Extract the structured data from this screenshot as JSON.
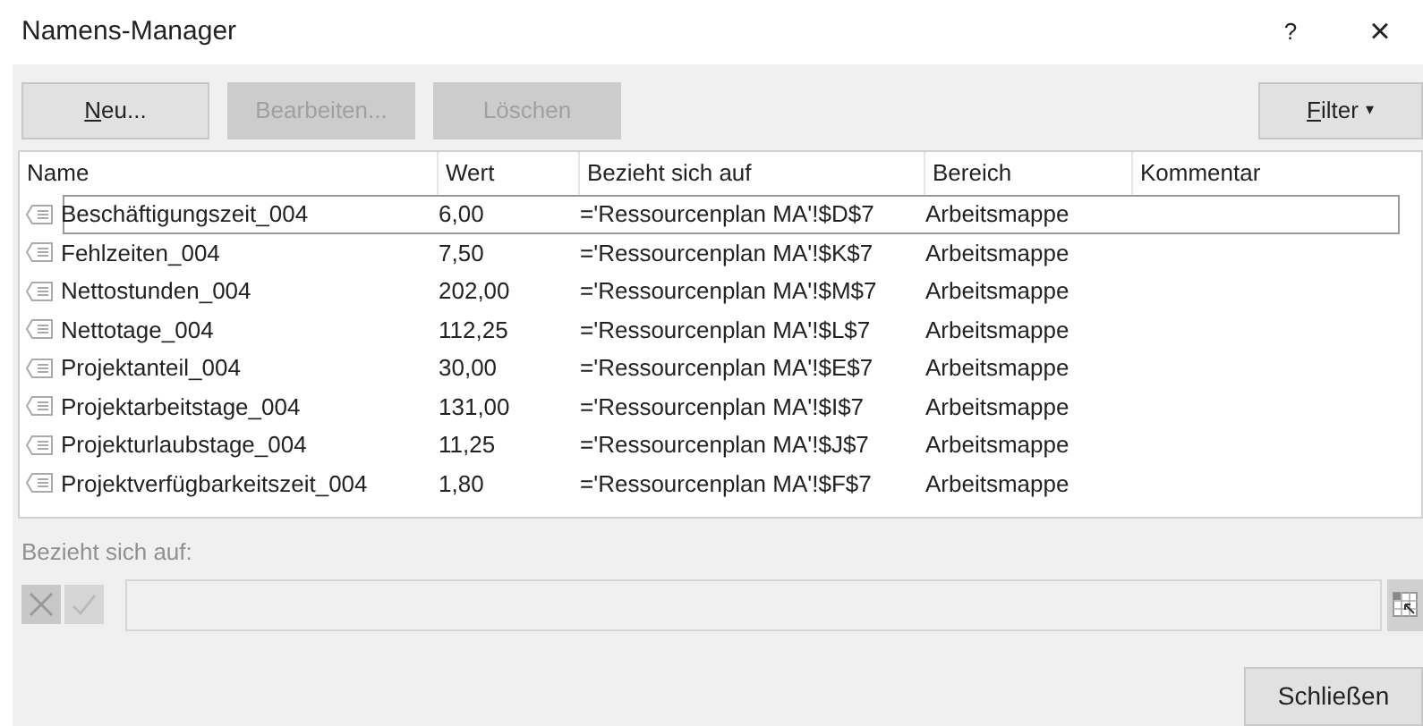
{
  "window": {
    "title": "Namens-Manager",
    "help": "?",
    "close": "×"
  },
  "buttons": [
    {
      "label": "Neu...",
      "disabled": false
    },
    {
      "label": "Bearbeiten...",
      "disabled": true
    },
    {
      "label": "Löschen",
      "disabled": true
    }
  ],
  "filter_button": {
    "label": "Filter",
    "caret": "▾"
  },
  "table": {
    "columns": [
      "Name",
      "Wert",
      "Bezieht sich auf",
      "Bereich",
      "Kommentar"
    ],
    "rows": [
      {
        "selected": true,
        "cells": [
          "Beschäftigungszeit_004",
          "6,00",
          "='Ressourcenplan MA'!$D$7",
          "Arbeitsmappe"
        ]
      },
      {
        "selected": false,
        "cells": [
          "Fehlzeiten_004",
          "7,50",
          "='Ressourcenplan MA'!$K$7",
          "Arbeitsmappe"
        ]
      },
      {
        "selected": false,
        "cells": [
          "Nettostunden_004",
          "202,00",
          "='Ressourcenplan MA'!$M$7",
          "Arbeitsmappe"
        ]
      },
      {
        "selected": false,
        "cells": [
          "Nettotage_004",
          "112,25",
          "='Ressourcenplan MA'!$L$7",
          "Arbeitsmappe"
        ]
      },
      {
        "selected": false,
        "cells": [
          "Projektanteil_004",
          "30,00",
          "='Ressourcenplan MA'!$E$7",
          "Arbeitsmappe"
        ]
      },
      {
        "selected": false,
        "cells": [
          "Projektarbeitstage_004",
          "131,00",
          "='Ressourcenplan MA'!$I$7",
          "Arbeitsmappe"
        ]
      },
      {
        "selected": false,
        "cells": [
          "Projekturlaubstage_004",
          "11,25",
          "='Ressourcenplan MA'!$J$7",
          "Arbeitsmappe"
        ]
      },
      {
        "selected": false,
        "cells": [
          "Projektverfügbarkeitszeit_004",
          "1,80",
          "='Ressourcenplan MA'!$F$7",
          "Arbeitsmappe"
        ]
      }
    ]
  },
  "refers_to": {
    "label": "Bezieht sich auf:",
    "disabled": true
  },
  "close_button": {
    "label": "Schließen"
  }
}
